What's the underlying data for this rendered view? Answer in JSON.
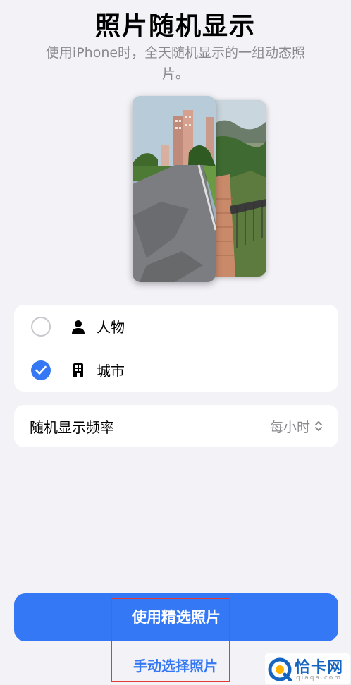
{
  "header": {
    "title": "照片随机显示",
    "subtitle": "使用iPhone时，全天随机显示的一组动态照片。"
  },
  "categories": [
    {
      "label": "人物",
      "icon": "person-icon",
      "selected": false
    },
    {
      "label": "城市",
      "icon": "building-icon",
      "selected": true
    }
  ],
  "frequency": {
    "label": "随机显示频率",
    "value": "每小时"
  },
  "buttons": {
    "primary": "使用精选照片",
    "secondary": "手动选择照片"
  },
  "watermark": {
    "text": "恰卡网",
    "sub": "qiaqa.com"
  },
  "colors": {
    "accent": "#3478f6",
    "background": "#f2f2f7",
    "highlight": "#e53935"
  }
}
